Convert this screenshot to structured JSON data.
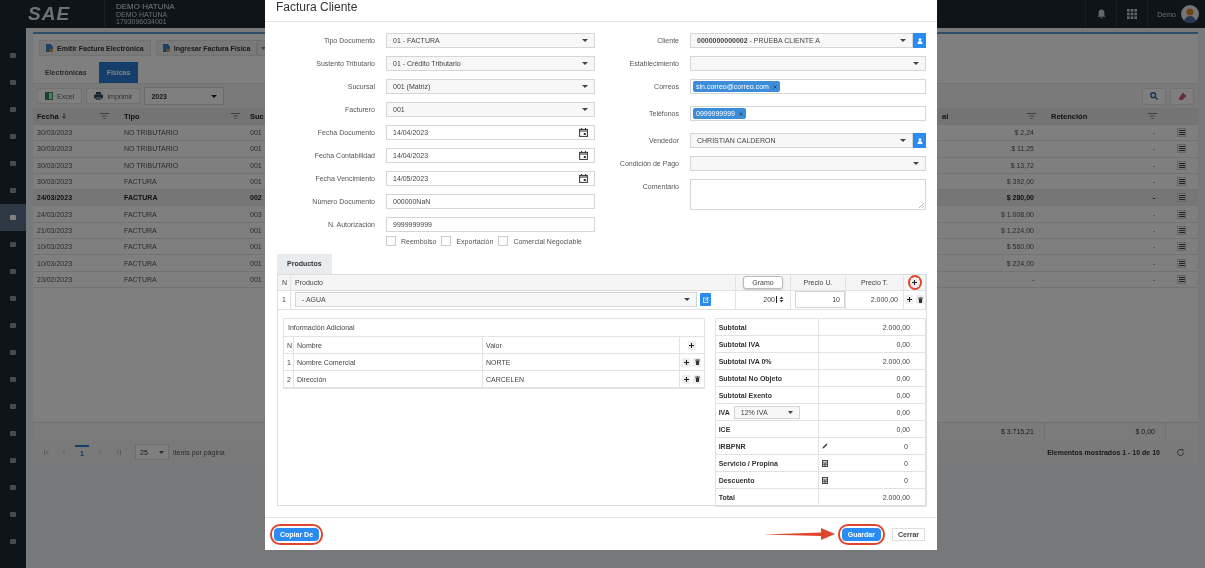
{
  "header": {
    "logo": "SAE",
    "company": "DEMO HATUNA",
    "company_sub": "DEMO HATUNA",
    "tax_id": "1793096034001",
    "user": "Demo"
  },
  "sidebar": [
    {
      "selected": false
    },
    {
      "selected": false
    },
    {
      "selected": false
    },
    {
      "selected": false
    },
    {
      "selected": false
    },
    {
      "selected": false
    },
    {
      "selected": true
    },
    {
      "selected": false
    },
    {
      "selected": false
    },
    {
      "selected": false
    },
    {
      "selected": false
    },
    {
      "selected": false
    },
    {
      "selected": false
    },
    {
      "selected": false
    },
    {
      "selected": false
    },
    {
      "selected": false
    },
    {
      "selected": false
    },
    {
      "selected": false
    },
    {
      "selected": false
    }
  ],
  "background": {
    "actions": [
      "Emitir Factura Electrónica",
      "Ingresar Factura Física"
    ],
    "tabs": [
      {
        "label": "Electrónicas",
        "selected": false
      },
      {
        "label": "Físicas",
        "selected": true
      }
    ],
    "toolbar": {
      "excel": "Excel",
      "print": "Imprimir",
      "year": "2023"
    },
    "columns": {
      "date": "Fecha",
      "type": "Tipo",
      "branch": "Suc",
      "total": "al",
      "withholding": "Retención"
    },
    "rows": [
      {
        "date": "30/03/2023",
        "type": "NO TRIBUTARIO",
        "branch": "001",
        "total": "$ 2,24",
        "withholding": "-",
        "selected": false
      },
      {
        "date": "30/03/2023",
        "type": "NO TRIBUTARIO",
        "branch": "001",
        "total": "$ 11,25",
        "withholding": "-",
        "selected": false
      },
      {
        "date": "30/03/2023",
        "type": "NO TRIBUTARIO",
        "branch": "001",
        "total": "$ 13,72",
        "withholding": "-",
        "selected": false
      },
      {
        "date": "30/03/2023",
        "type": "FACTURA",
        "branch": "001",
        "total": "$ 392,00",
        "withholding": "-",
        "selected": false
      },
      {
        "date": "24/03/2023",
        "type": "FACTURA",
        "branch": "002",
        "total": "$ 280,00",
        "withholding": "-",
        "selected": true
      },
      {
        "date": "24/03/2023",
        "type": "FACTURA",
        "branch": "003",
        "total": "$ 1.008,00",
        "withholding": "-",
        "selected": false
      },
      {
        "date": "21/03/2023",
        "type": "FACTURA",
        "branch": "001",
        "total": "$ 1.224,00",
        "withholding": "-",
        "selected": false
      },
      {
        "date": "10/03/2023",
        "type": "FACTURA",
        "branch": "001",
        "total": "$ 560,00",
        "withholding": "-",
        "selected": false
      },
      {
        "date": "10/03/2023",
        "type": "FACTURA",
        "branch": "001",
        "total": "$ 224,00",
        "withholding": "-",
        "selected": false
      },
      {
        "date": "23/02/2023",
        "type": "FACTURA",
        "branch": "001",
        "total": "-",
        "withholding": "-",
        "selected": false
      }
    ],
    "totals": {
      "total": "$ 3.715,21",
      "withholding": "$ 0,00"
    },
    "pagination": {
      "page": "1",
      "page_size": "25",
      "page_size_label": "items por página",
      "summary": "Elementos mostrados 1 - 10 de 10"
    }
  },
  "modal": {
    "title": "Factura Cliente",
    "left_fields": [
      {
        "label": "Tipo Documento",
        "kind": "select",
        "value": "01 - FACTURA"
      },
      {
        "label": "Sustento Tributario",
        "kind": "select",
        "value": "01 - Crédito Tributario"
      },
      {
        "label": "Sucursal",
        "kind": "select",
        "value": "001 (Matriz)"
      },
      {
        "label": "Facturero",
        "kind": "select",
        "value": "001"
      },
      {
        "label": "Fecha Documento",
        "kind": "date",
        "value": "14/04/2023"
      },
      {
        "label": "Fecha Contabilidad",
        "kind": "date",
        "value": "14/04/2023"
      },
      {
        "label": "Fecha Vencimiento",
        "kind": "date",
        "value": "14/05/2023"
      },
      {
        "label": "Número Documento",
        "kind": "text",
        "value": "000000NaN"
      },
      {
        "label": "N. Autorización",
        "kind": "text",
        "value": "9999999999"
      }
    ],
    "options": [
      {
        "label": "Reembolso",
        "checked": false
      },
      {
        "label": "Exportación",
        "checked": false
      },
      {
        "label": "Comercial Negociable",
        "checked": false
      }
    ],
    "right_fields": [
      {
        "label": "Cliente",
        "kind": "select",
        "value": "**0000000000002** - PRUEBA CLIENTE A",
        "add_button": true
      },
      {
        "label": "Establecimiento",
        "kind": "select",
        "add_button": false
      },
      {
        "label": "Correos",
        "kind": "tags",
        "tags": [
          "sin.correo@correo.com"
        ]
      },
      {
        "label": "Teléfonos",
        "kind": "tags",
        "tags": [
          "0999999999"
        ]
      },
      {
        "label": "Vendedor",
        "kind": "select",
        "value": "CHRISTIAN CALDERON",
        "add_button": true
      },
      {
        "label": "Condición de Pago",
        "kind": "select",
        "add_button": false
      },
      {
        "label": "Comentario",
        "kind": "textarea"
      }
    ],
    "products": {
      "tab": "Productos",
      "columns": {
        "n": "N",
        "product": "Producto",
        "unit": "Gramo",
        "unit_price": "Precio U.",
        "total": "Precio T."
      },
      "add_highlighted": true,
      "rows": [
        {
          "n": "1",
          "product": "- AGUA",
          "quantity": "200",
          "unit_price": "10",
          "total": "2.000,00"
        }
      ]
    },
    "additional_info": {
      "title": "Información Adicional",
      "columns": {
        "n": "N",
        "name": "Nombre",
        "value": "Valor"
      },
      "rows": [
        {
          "n": "1",
          "name": "Nombre Comercial",
          "value": "NORTE"
        },
        {
          "n": "2",
          "name": "Dirección",
          "value": "CARCELEN"
        }
      ]
    },
    "totals": [
      {
        "label": "Subtotal",
        "kind": "plain",
        "value": "2.000,00"
      },
      {
        "label": "Subtotal IVA",
        "kind": "plain",
        "value": "0,00"
      },
      {
        "label": "Subtotal IVA 0%",
        "kind": "plain",
        "value": "2.000,00"
      },
      {
        "label": "Subtotal No Objeto",
        "kind": "plain",
        "value": "0,00"
      },
      {
        "label": "Subtotal Exento",
        "kind": "plain",
        "value": "0,00"
      },
      {
        "label": "IVA",
        "kind": "select",
        "option": "12% IVA",
        "value": "0,00"
      },
      {
        "label": "ICE",
        "kind": "plain",
        "value": "0,00"
      },
      {
        "label": "IRBPNR",
        "kind": "pencil",
        "value": "0"
      },
      {
        "label": "Servicio / Propina",
        "kind": "calculator",
        "value": "0"
      },
      {
        "label": "Descuento",
        "kind": "calculator",
        "value": "0"
      },
      {
        "label": "Total",
        "kind": "plain",
        "value": "2.000,00"
      }
    ],
    "footer": {
      "copy": {
        "label": "Copiar De",
        "highlighted": true
      },
      "save": {
        "label": "Guardar",
        "highlighted": true
      },
      "close": {
        "label": "Cerrar",
        "highlighted": false
      }
    }
  }
}
